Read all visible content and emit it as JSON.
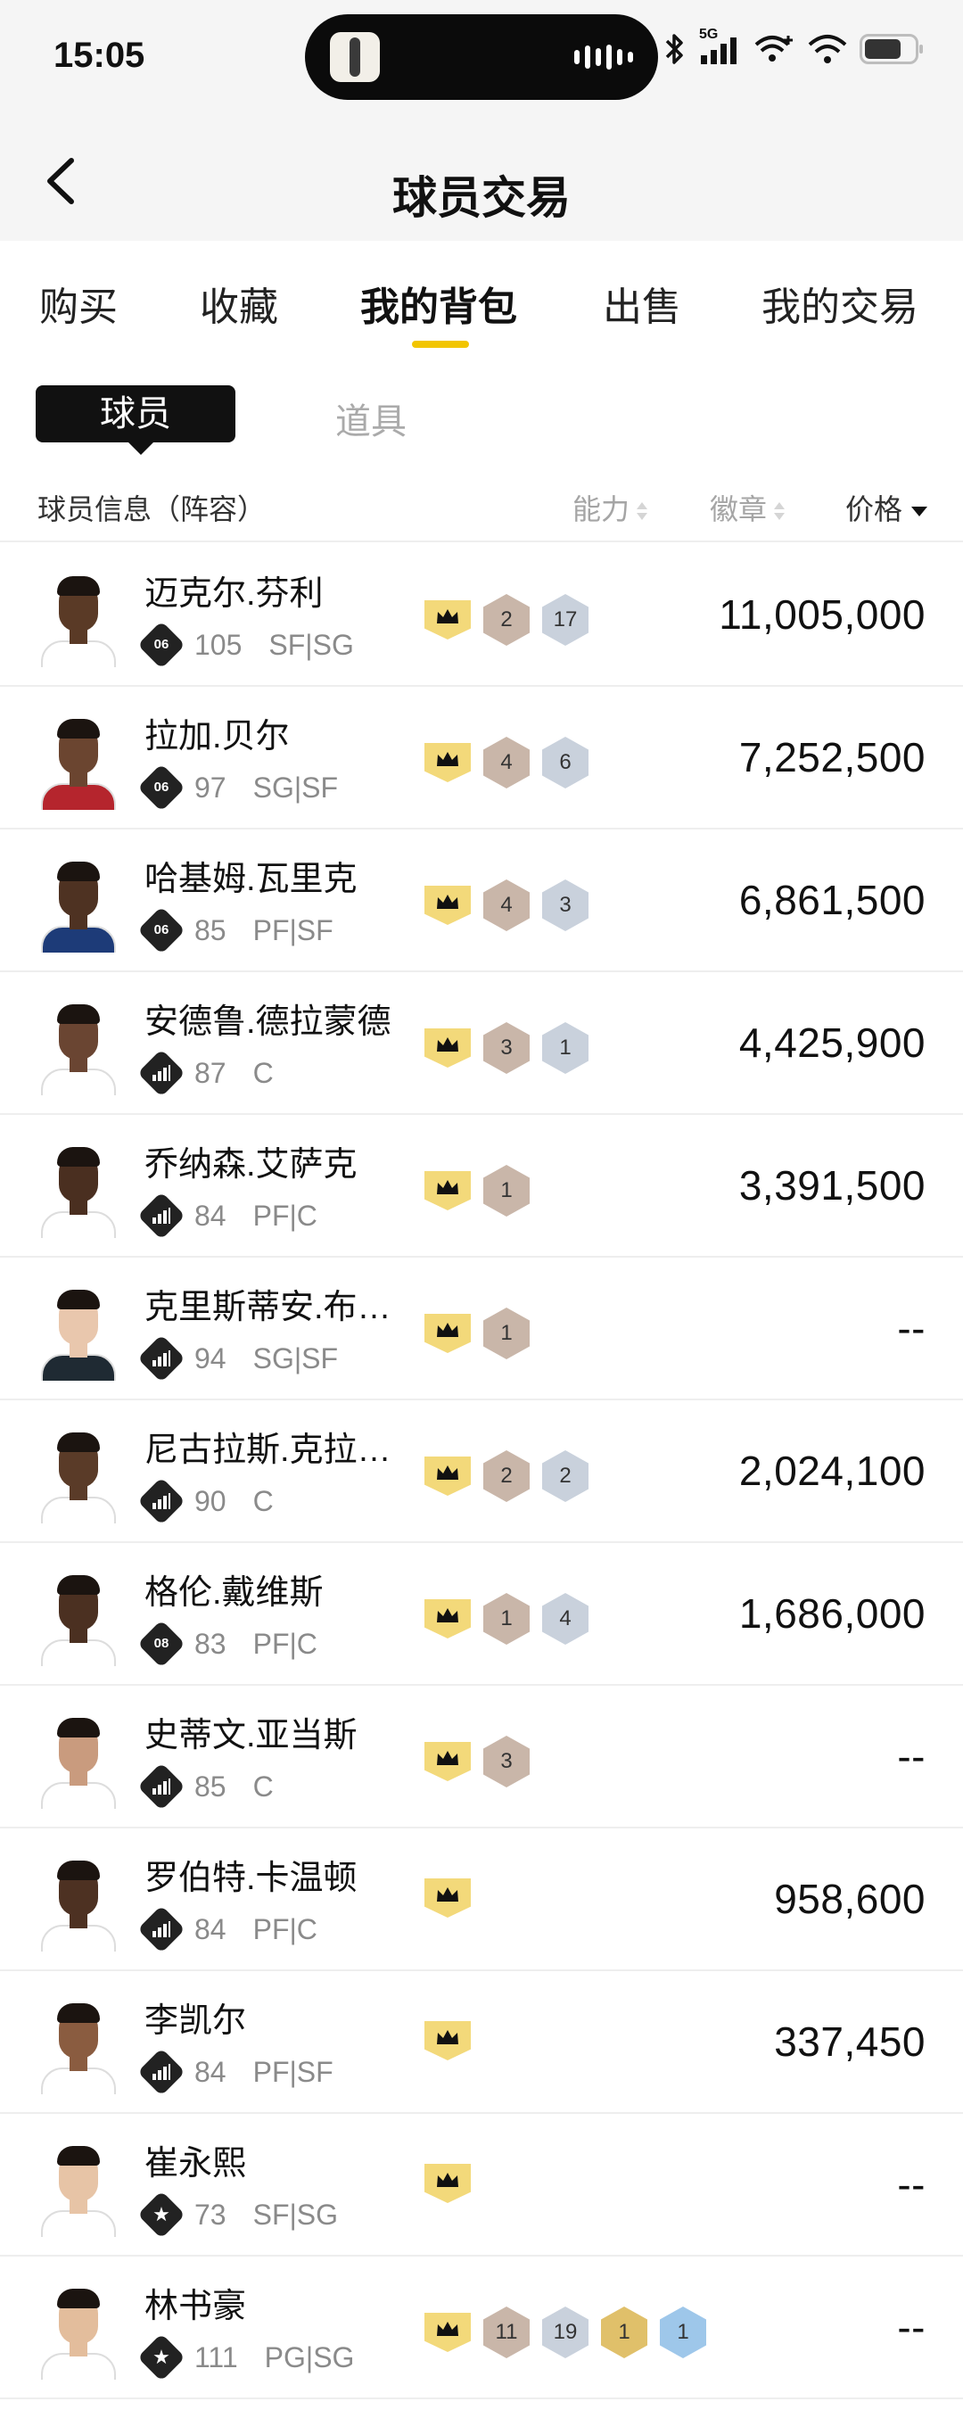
{
  "status_bar": {
    "time": "15:05",
    "network": "5G"
  },
  "header": {
    "title": "球员交易"
  },
  "tabs": [
    {
      "label": "购买"
    },
    {
      "label": "收藏"
    },
    {
      "label": "我的背包"
    },
    {
      "label": "出售"
    },
    {
      "label": "我的交易"
    }
  ],
  "subtabs": {
    "active": "球员",
    "inactive": "道具"
  },
  "columns": {
    "info": "球员信息（阵容）",
    "ability": "能力",
    "badges": "徽章",
    "price": "价格"
  },
  "players": [
    {
      "name": "迈克尔.芬利",
      "icon_label": "06",
      "icon_type": "era",
      "rating": "105",
      "position": "SF|SG",
      "badges": [
        {
          "v": "2",
          "c": "bronze"
        },
        {
          "v": "17",
          "c": "silver"
        }
      ],
      "price": "11,005,000",
      "skin": "#5a3a26",
      "jersey": "#ffffff"
    },
    {
      "name": "拉加.贝尔",
      "icon_label": "06",
      "icon_type": "era",
      "rating": "97",
      "position": "SG|SF",
      "badges": [
        {
          "v": "4",
          "c": "bronze"
        },
        {
          "v": "6",
          "c": "silver"
        }
      ],
      "price": "7,252,500",
      "skin": "#6b4530",
      "jersey": "#b5252d"
    },
    {
      "name": "哈基姆.瓦里克",
      "icon_label": "06",
      "icon_type": "era",
      "rating": "85",
      "position": "PF|SF",
      "badges": [
        {
          "v": "4",
          "c": "bronze"
        },
        {
          "v": "3",
          "c": "silver"
        }
      ],
      "price": "6,861,500",
      "skin": "#4e3222",
      "jersey": "#1d3b78"
    },
    {
      "name": "安德鲁.德拉蒙德",
      "icon_label": "",
      "icon_type": "bars",
      "rating": "87",
      "position": "C",
      "badges": [
        {
          "v": "3",
          "c": "bronze"
        },
        {
          "v": "1",
          "c": "silver"
        }
      ],
      "price": "4,425,900",
      "skin": "#6a4532",
      "jersey": "#ffffff"
    },
    {
      "name": "乔纳森.艾萨克",
      "icon_label": "",
      "icon_type": "bars",
      "rating": "84",
      "position": "PF|C",
      "badges": [
        {
          "v": "1",
          "c": "bronze"
        }
      ],
      "price": "3,391,500",
      "skin": "#4a2f20",
      "jersey": "#ffffff"
    },
    {
      "name": "克里斯蒂安.布…",
      "icon_label": "",
      "icon_type": "bars",
      "rating": "94",
      "position": "SG|SF",
      "badges": [
        {
          "v": "1",
          "c": "bronze"
        }
      ],
      "price": "--",
      "skin": "#e9c7ad",
      "jersey": "#1f2a33"
    },
    {
      "name": "尼古拉斯.克拉…",
      "icon_label": "",
      "icon_type": "bars",
      "rating": "90",
      "position": "C",
      "badges": [
        {
          "v": "2",
          "c": "bronze"
        },
        {
          "v": "2",
          "c": "silver"
        }
      ],
      "price": "2,024,100",
      "skin": "#5a3b28",
      "jersey": "#ffffff"
    },
    {
      "name": "格伦.戴维斯",
      "icon_label": "08",
      "icon_type": "era",
      "rating": "83",
      "position": "PF|C",
      "badges": [
        {
          "v": "1",
          "c": "bronze"
        },
        {
          "v": "4",
          "c": "silver"
        }
      ],
      "price": "1,686,000",
      "skin": "#4b3021",
      "jersey": "#ffffff"
    },
    {
      "name": "史蒂文.亚当斯",
      "icon_label": "",
      "icon_type": "bars",
      "rating": "85",
      "position": "C",
      "badges": [
        {
          "v": "3",
          "c": "bronze"
        }
      ],
      "price": "--",
      "skin": "#c99b7e",
      "jersey": "#ffffff"
    },
    {
      "name": "罗伯特.卡温顿",
      "icon_label": "",
      "icon_type": "bars",
      "rating": "84",
      "position": "PF|C",
      "badges": [],
      "price": "958,600",
      "skin": "#4d3122",
      "jersey": "#ffffff"
    },
    {
      "name": "李凯尔",
      "icon_label": "",
      "icon_type": "bars",
      "rating": "84",
      "position": "PF|SF",
      "badges": [],
      "price": "337,450",
      "skin": "#8a5c40",
      "jersey": "#ffffff"
    },
    {
      "name": "崔永熙",
      "icon_label": "",
      "icon_type": "star",
      "rating": "73",
      "position": "SF|SG",
      "badges": [],
      "price": "--",
      "skin": "#e7c4a6",
      "jersey": "#ffffff"
    },
    {
      "name": "林书豪",
      "icon_label": "",
      "icon_type": "star",
      "rating": "111",
      "position": "PG|SG",
      "badges": [
        {
          "v": "11",
          "c": "bronze"
        },
        {
          "v": "19",
          "c": "silver"
        },
        {
          "v": "1",
          "c": "gold"
        },
        {
          "v": "1",
          "c": "blue"
        }
      ],
      "price": "--",
      "skin": "#e3bd9c",
      "jersey": "#ffffff"
    }
  ],
  "colors": {
    "accent": "#f2c500",
    "crown": "#f3d97a",
    "bronze": "#c9b6a9",
    "silver": "#c9d1dc",
    "gold": "#e0c06a",
    "blue": "#9ec7ea"
  }
}
